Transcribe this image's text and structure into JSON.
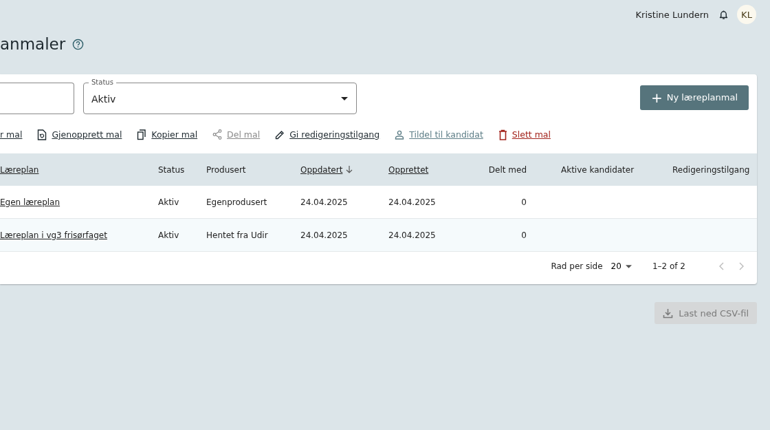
{
  "user": {
    "name": "Kristine Lundern",
    "initials": "KL"
  },
  "page_title": "anmaler",
  "filters": {
    "status": {
      "label": "Status",
      "value": "Aktiv"
    }
  },
  "new_button": {
    "icon": "+",
    "label": "Ny læreplanmal"
  },
  "actions": [
    {
      "label": "r mal",
      "kind": "normal"
    },
    {
      "label": "Gjenopprett mal",
      "kind": "normal"
    },
    {
      "label": "Kopier mal",
      "kind": "normal"
    },
    {
      "label": "Del mal",
      "kind": "disabled"
    },
    {
      "label": "Gi redigeringstilgang",
      "kind": "normal"
    },
    {
      "label": "Tildel til kandidat",
      "kind": "muted"
    },
    {
      "label": "Slett mal",
      "kind": "danger"
    }
  ],
  "table": {
    "columns": [
      {
        "label": "Læreplan",
        "sortable": true,
        "sorted": false
      },
      {
        "label": "Status",
        "sortable": false
      },
      {
        "label": "Produsert",
        "sortable": false
      },
      {
        "label": "Oppdatert",
        "sortable": true,
        "sorted": true
      },
      {
        "label": "Opprettet",
        "sortable": true,
        "sorted": false
      },
      {
        "label": "Delt med",
        "sortable": false
      },
      {
        "label": "Aktive kandidater",
        "sortable": false
      },
      {
        "label": "Redigeringstilgang",
        "sortable": false
      }
    ],
    "rows": [
      [
        "Egen læreplan",
        "Aktiv",
        "Egenprodusert",
        "24.04.2025",
        "24.04.2025",
        "0",
        "",
        ""
      ],
      [
        "Læreplan i vg3 frisørfaget",
        "Aktiv",
        "Hentet fra Udir",
        "24.04.2025",
        "24.04.2025",
        "0",
        "",
        ""
      ]
    ]
  },
  "pagination": {
    "rows_label": "Rad per side",
    "rows_value": "20",
    "range": "1–2 of 2",
    "prev_disabled": true,
    "next_disabled": true
  },
  "download_button": {
    "label": "Last ned CSV-fil",
    "disabled": true
  }
}
